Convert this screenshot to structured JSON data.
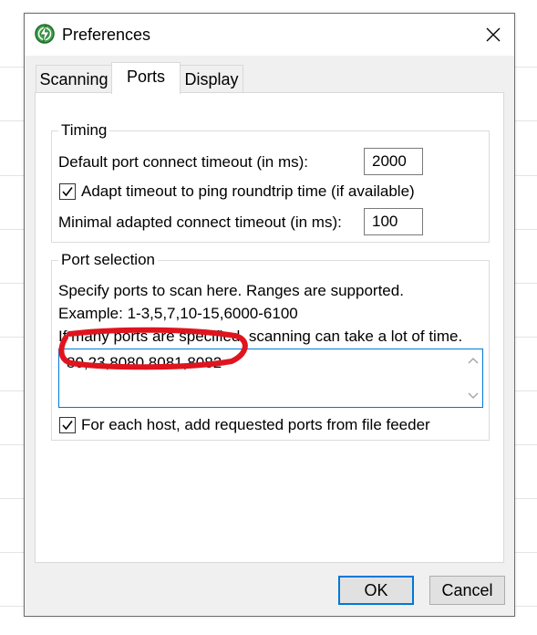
{
  "window": {
    "title": "Preferences"
  },
  "tabs": [
    {
      "label": "Scanning"
    },
    {
      "label": "Ports"
    },
    {
      "label": "Display"
    }
  ],
  "timing": {
    "group_title": "Timing",
    "default_timeout_label": "Default port connect timeout (in ms):",
    "default_timeout_value": "2000",
    "adapt_label": "Adapt timeout to ping roundtrip time (if available)",
    "adapt_checked": true,
    "min_timeout_label": "Minimal adapted connect timeout (in ms):",
    "min_timeout_value": "100"
  },
  "port_selection": {
    "group_title": "Port selection",
    "help_line1": "Specify ports to scan here. Ranges are supported.",
    "help_line2": "Example: 1-3,5,7,10-15,6000-6100",
    "help_line3": "If many ports are specified, scanning can take a lot of time.",
    "ports_value": "80,23,8080,8081,8082",
    "feeder_label": "For each host, add requested ports from file feeder",
    "feeder_checked": true
  },
  "buttons": {
    "ok": "OK",
    "cancel": "Cancel"
  },
  "colors": {
    "annotation": "#e0141e",
    "focus": "#0078d7",
    "app_icon": "#3fa34d"
  }
}
